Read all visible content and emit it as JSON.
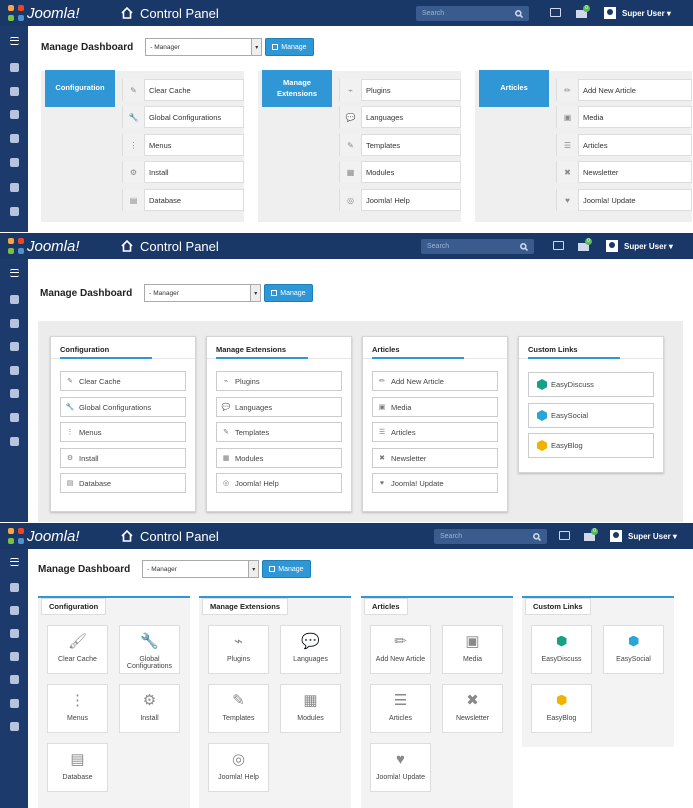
{
  "topbar": {
    "logo": "Joomla!",
    "title": "Control Panel",
    "search_placeholder": "Search",
    "mail_badge": "0",
    "user": "Super User ▾"
  },
  "dashboard": {
    "label": "Manage Dashboard",
    "select_value": "- Manager",
    "manage_button": "Manage"
  },
  "groups": {
    "configuration": "Configuration",
    "extensions": "Manage Extensions",
    "articles": "Articles",
    "custom_links": "Custom Links"
  },
  "configuration_items": [
    "Clear Cache",
    "Global Configurations",
    "Menus",
    "Install",
    "Database"
  ],
  "extension_items": [
    "Plugins",
    "Languages",
    "Templates",
    "Modules",
    "Joomla! Help"
  ],
  "article_items": [
    "Add New Article",
    "Media",
    "Articles",
    "Newsletter",
    "Joomla! Update"
  ],
  "custom_links": [
    "EasyDiscuss",
    "EasySocial",
    "EasyBlog"
  ],
  "custom_link_colors": [
    "#16a085",
    "#2aa5d8",
    "#f0b400"
  ],
  "accent_color": "#2f97d5",
  "topbar_color": "#1a3867"
}
